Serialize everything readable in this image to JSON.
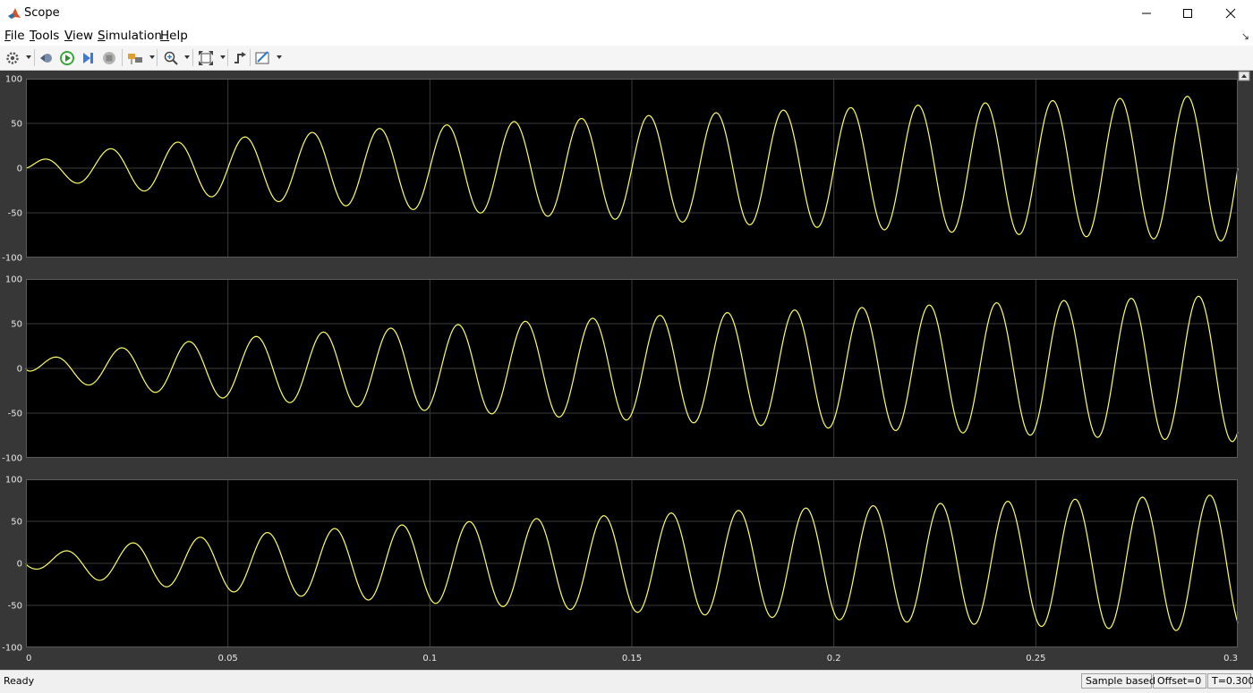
{
  "window": {
    "title": "Scope"
  },
  "menu": [
    {
      "label": "File",
      "u": "F",
      "rest": "ile"
    },
    {
      "label": "Tools",
      "u": "T",
      "rest": "ools"
    },
    {
      "label": "View",
      "u": "V",
      "rest": "iew"
    },
    {
      "label": "Simulation",
      "u": "S",
      "rest": "imulation"
    },
    {
      "label": "Help",
      "u": "H",
      "rest": "elp"
    }
  ],
  "toolbar": [
    "settings-icon",
    "step-back-icon",
    "run-icon",
    "step-forward-icon",
    "stop-icon",
    "highlight-block-icon",
    "zoom-in-icon",
    "fit-to-view-icon",
    "triggers-icon",
    "measurements-icon"
  ],
  "colors": {
    "plot_bg": "#000000",
    "frame_bg": "#373737",
    "trace": "#ffff66",
    "grid": "#3c3c3c"
  },
  "chart_data": [
    {
      "type": "line",
      "series": [
        {
          "values": "y1"
        }
      ],
      "ylim": [
        -100,
        100
      ],
      "xlim": [
        0,
        0.3
      ],
      "yticks": [
        "100",
        "50",
        "0",
        "-50",
        "-100"
      ],
      "grid": true,
      "trace_color": "#ffff66",
      "waveform": {
        "frequency_hz": 60,
        "amplitude_start": 0,
        "amplitude_end": 82,
        "phase_deg": 0
      }
    },
    {
      "type": "line",
      "series": [
        {
          "values": "y2"
        }
      ],
      "ylim": [
        -100,
        100
      ],
      "xlim": [
        0,
        0.3
      ],
      "yticks": [
        "100",
        "50",
        "0",
        "-50",
        "-100"
      ],
      "grid": true,
      "trace_color": "#ffff66",
      "waveform": {
        "frequency_hz": 60,
        "amplitude_start": 0,
        "amplitude_end": 82,
        "phase_deg": -60
      }
    },
    {
      "type": "line",
      "series": [
        {
          "values": "y3"
        }
      ],
      "ylim": [
        -100,
        100
      ],
      "xlim": [
        0,
        0.3
      ],
      "yticks": [
        "100",
        "50",
        "0",
        "-50",
        "-100"
      ],
      "xticks": [
        "0",
        "0.05",
        "0.1",
        "0.15",
        "0.2",
        "0.25",
        "0.3"
      ],
      "grid": true,
      "trace_color": "#ffff66",
      "waveform": {
        "frequency_hz": 60,
        "amplitude_start": 0,
        "amplitude_end": 82,
        "phase_deg": -120
      }
    }
  ],
  "status": {
    "left": "Ready",
    "mode": "Sample based",
    "offset": "Offset=0",
    "time": "T=0.300"
  }
}
